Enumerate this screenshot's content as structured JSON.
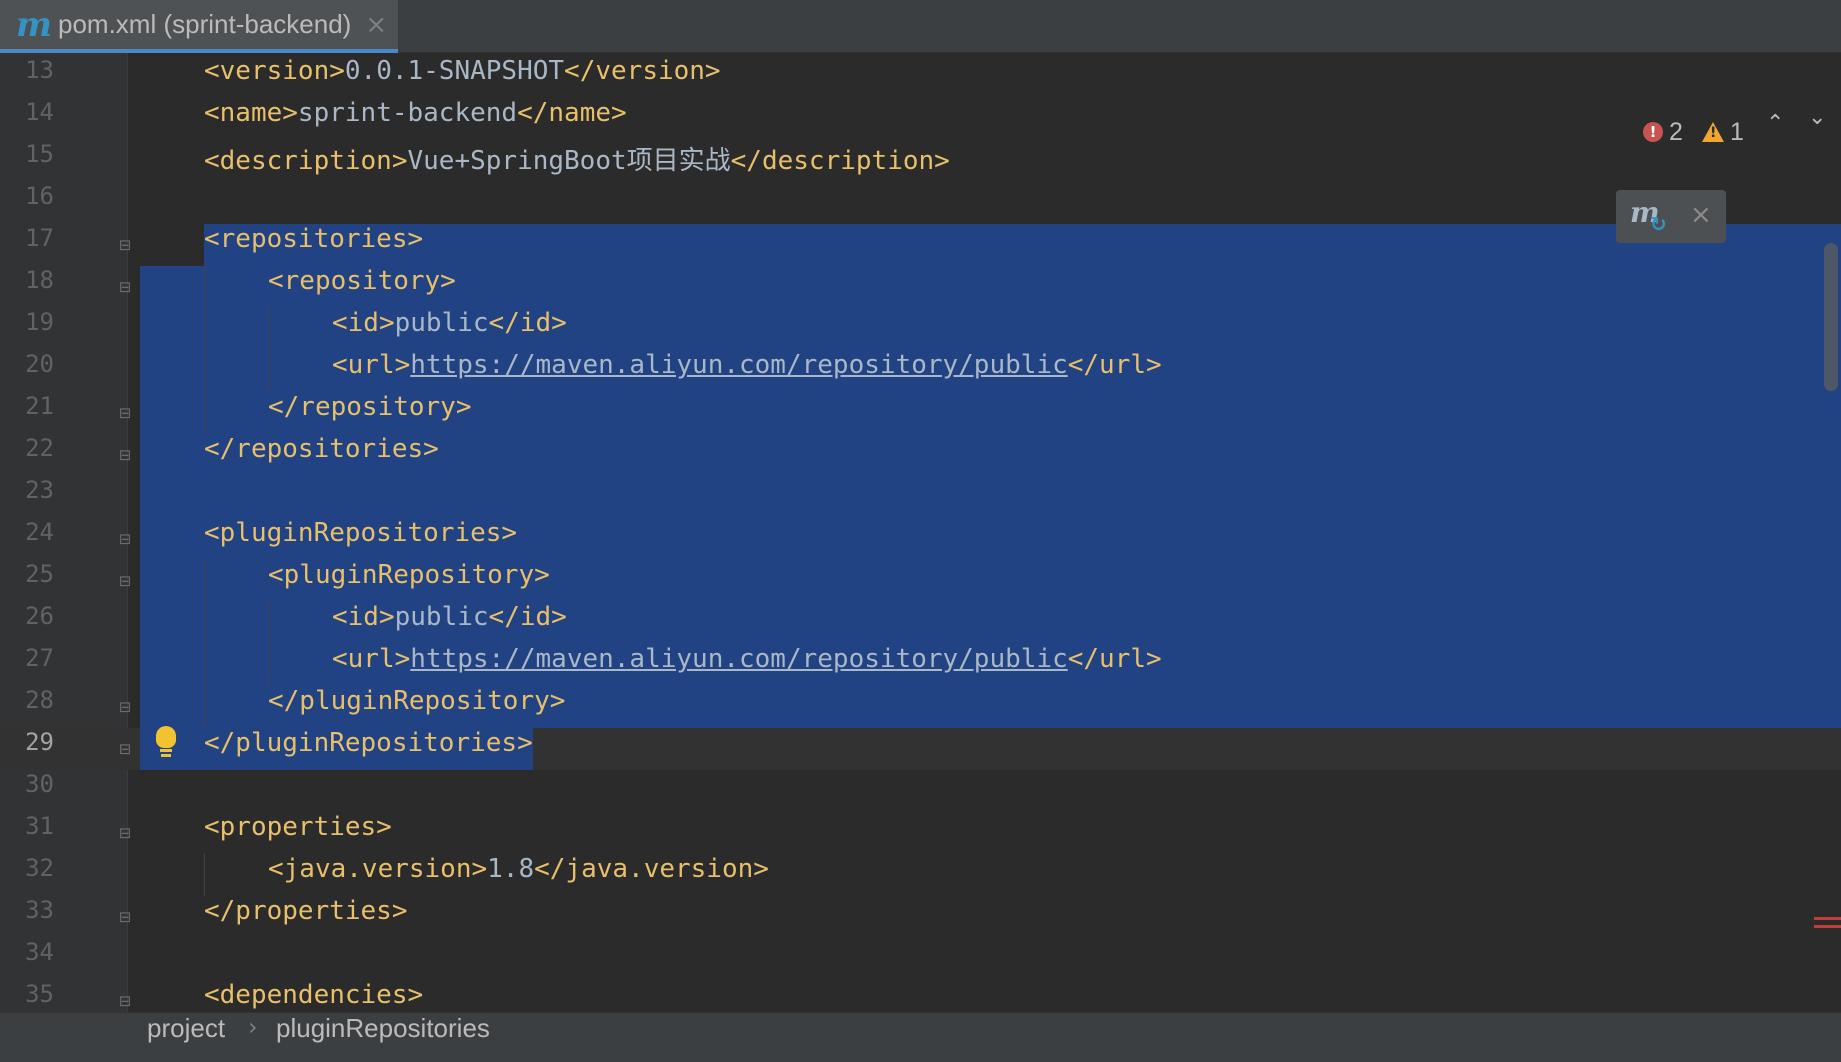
{
  "tab": {
    "icon": "maven-icon",
    "glyph": "m",
    "title": "pom.xml (sprint-backend)",
    "close": "×"
  },
  "lines": [
    {
      "num": "13",
      "indent": 1,
      "parts": [
        [
          "tag",
          "<version>"
        ],
        [
          "txt",
          "0.0.1-SNAPSHOT"
        ],
        [
          "tag",
          "</version>"
        ]
      ]
    },
    {
      "num": "14",
      "indent": 1,
      "parts": [
        [
          "tag",
          "<name>"
        ],
        [
          "txt",
          "sprint-backend"
        ],
        [
          "tag",
          "</name>"
        ]
      ]
    },
    {
      "num": "15",
      "indent": 1,
      "parts": [
        [
          "tag",
          "<description>"
        ],
        [
          "txt",
          "Vue+SpringBoot项目实战"
        ],
        [
          "tag",
          "</description>"
        ]
      ]
    },
    {
      "num": "16",
      "indent": 0,
      "parts": []
    },
    {
      "num": "17",
      "indent": 1,
      "parts": [
        [
          "tag",
          "<repositories>"
        ]
      ],
      "fold": "open"
    },
    {
      "num": "18",
      "indent": 2,
      "parts": [
        [
          "tag",
          "<repository>"
        ]
      ],
      "fold": "open"
    },
    {
      "num": "19",
      "indent": 3,
      "parts": [
        [
          "tag",
          "<id>"
        ],
        [
          "txt",
          "public"
        ],
        [
          "tag",
          "</id>"
        ]
      ]
    },
    {
      "num": "20",
      "indent": 3,
      "parts": [
        [
          "tag",
          "<url>"
        ],
        [
          "url",
          "https://maven.aliyun.com/repository/public"
        ],
        [
          "tag",
          "</url>"
        ]
      ]
    },
    {
      "num": "21",
      "indent": 2,
      "parts": [
        [
          "tag",
          "</repository>"
        ]
      ],
      "fold": "close"
    },
    {
      "num": "22",
      "indent": 1,
      "parts": [
        [
          "tag",
          "</repositories>"
        ]
      ],
      "fold": "close"
    },
    {
      "num": "23",
      "indent": 0,
      "parts": []
    },
    {
      "num": "24",
      "indent": 1,
      "parts": [
        [
          "tag",
          "<pluginRepositories>"
        ]
      ],
      "fold": "open"
    },
    {
      "num": "25",
      "indent": 2,
      "parts": [
        [
          "tag",
          "<pluginRepository>"
        ]
      ],
      "fold": "open"
    },
    {
      "num": "26",
      "indent": 3,
      "parts": [
        [
          "tag",
          "<id>"
        ],
        [
          "txt",
          "public"
        ],
        [
          "tag",
          "</id>"
        ]
      ]
    },
    {
      "num": "27",
      "indent": 3,
      "parts": [
        [
          "tag",
          "<url>"
        ],
        [
          "url",
          "https://maven.aliyun.com/repository/public"
        ],
        [
          "tag",
          "</url>"
        ]
      ]
    },
    {
      "num": "28",
      "indent": 2,
      "parts": [
        [
          "tag",
          "</pluginRepository>"
        ]
      ],
      "fold": "close"
    },
    {
      "num": "29",
      "indent": 1,
      "parts": [
        [
          "tag",
          "</pluginRepositories>"
        ]
      ],
      "fold": "close",
      "current": true
    },
    {
      "num": "30",
      "indent": 0,
      "parts": []
    },
    {
      "num": "31",
      "indent": 1,
      "parts": [
        [
          "tag",
          "<properties>"
        ]
      ],
      "fold": "open"
    },
    {
      "num": "32",
      "indent": 2,
      "parts": [
        [
          "tag",
          "<java.version>"
        ],
        [
          "txt",
          "1.8"
        ],
        [
          "tag",
          "</java.version>"
        ]
      ]
    },
    {
      "num": "33",
      "indent": 1,
      "parts": [
        [
          "tag",
          "</properties>"
        ]
      ],
      "fold": "close"
    },
    {
      "num": "34",
      "indent": 0,
      "parts": []
    },
    {
      "num": "35",
      "indent": 1,
      "parts": [
        [
          "tag",
          "<dependencies>"
        ]
      ],
      "fold": "open"
    }
  ],
  "inspections": {
    "errors": "2",
    "warnings": "1",
    "error_icon": "error-icon",
    "warning_icon": "warning-icon",
    "up": "⌃",
    "down": "⌄"
  },
  "maven_popup": {
    "icon": "maven-reload-icon",
    "glyph": "m",
    "sync_glyph": "↻",
    "close": "×"
  },
  "intention": {
    "icon": "lightbulb-icon"
  },
  "breadcrumb": {
    "items": [
      "project",
      "pluginRepositories"
    ],
    "separator": "›"
  }
}
